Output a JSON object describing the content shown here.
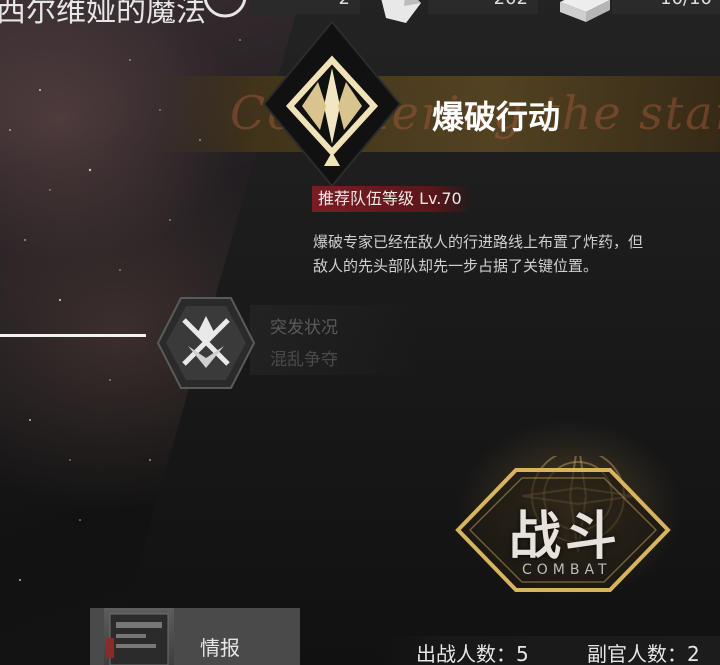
{
  "header": {
    "title": "西尔维娅的魔法",
    "resources": [
      {
        "icon": "timer-icon",
        "value": "2"
      },
      {
        "icon": "crystal-icon",
        "value": "202"
      },
      {
        "icon": "supply-box-icon",
        "value": "10/10"
      }
    ]
  },
  "mission": {
    "title": "爆破行动",
    "banner_script": "Conquering the stars",
    "recommended_level": "推荐队伍等级 Lv.70",
    "description_lines": [
      "爆破专家已经在敌人的行进路线上布置了炸药，但",
      "敌人的先头部队却先一步占据了关键位置。"
    ]
  },
  "sub_mission": {
    "title": "突发状况",
    "subtitle": "混乱争夺"
  },
  "combat": {
    "label": "战斗",
    "sublabel": "COMBAT"
  },
  "intel": {
    "label": "情报"
  },
  "stats": {
    "deploy": "出战人数：5",
    "adjutant": "副官人数：2"
  },
  "colors": {
    "gold": "#d9b45f",
    "level_badge": "#7a1d22"
  }
}
